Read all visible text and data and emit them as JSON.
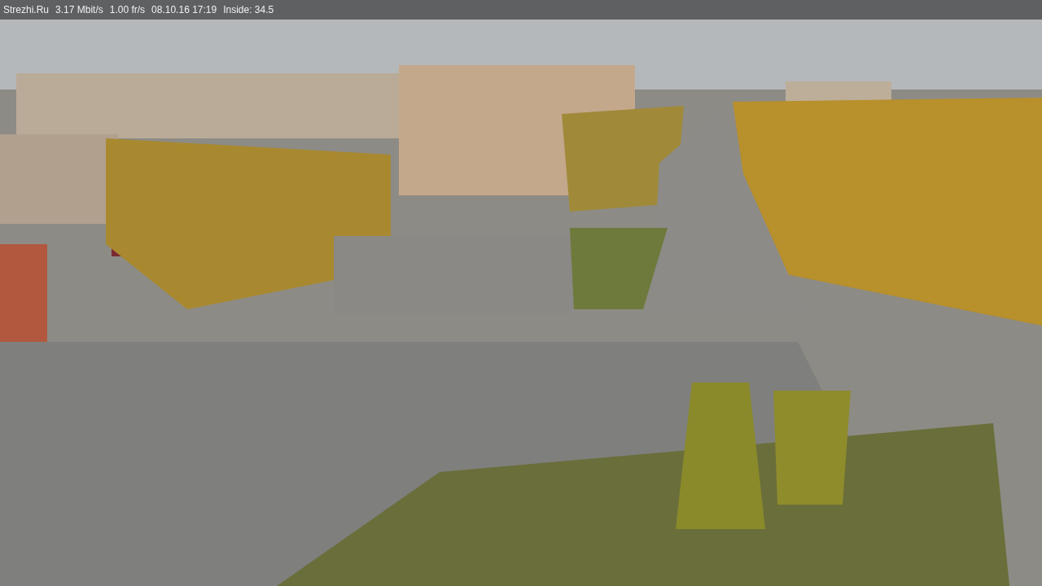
{
  "overlay": {
    "texts": [
      "Strezhi.Ru",
      "3.17 Mbit/s",
      "1.00 fr/s",
      "08.10.16 17:19",
      "Inside: 34.5"
    ]
  }
}
